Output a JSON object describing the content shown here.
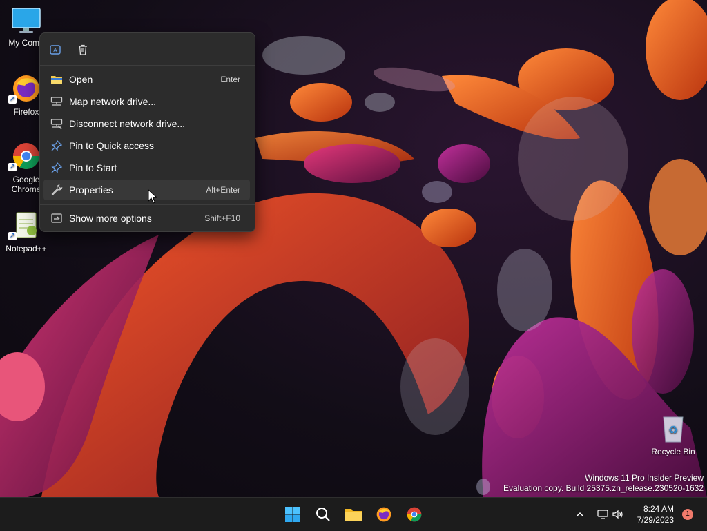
{
  "desktop": {
    "icons": [
      {
        "label": "My Comp"
      },
      {
        "label": "Firefox"
      },
      {
        "label": "Google Chrome"
      },
      {
        "label": "Notepad++"
      },
      {
        "label": "Recycle Bin"
      }
    ]
  },
  "context_menu": {
    "quick_actions": [
      {
        "icon": "rename-icon"
      },
      {
        "icon": "delete-icon"
      }
    ],
    "items": [
      {
        "label": "Open",
        "shortcut": "Enter",
        "icon": "folder-icon"
      },
      {
        "label": "Map network drive...",
        "shortcut": "",
        "icon": "network-drive-icon"
      },
      {
        "label": "Disconnect network drive...",
        "shortcut": "",
        "icon": "disconnect-drive-icon"
      },
      {
        "label": "Pin to Quick access",
        "shortcut": "",
        "icon": "pin-icon"
      },
      {
        "label": "Pin to Start",
        "shortcut": "",
        "icon": "pin-icon"
      },
      {
        "label": "Properties",
        "shortcut": "Alt+Enter",
        "icon": "wrench-icon"
      },
      {
        "label": "Show more options",
        "shortcut": "Shift+F10",
        "icon": "more-options-icon"
      }
    ],
    "hovered": "Properties"
  },
  "watermark": {
    "line1": "Windows 11 Pro Insider Preview",
    "line2": "Evaluation copy. Build 25375.zn_release.230520-1632"
  },
  "taskbar": {
    "apps": [
      {
        "name": "start-icon"
      },
      {
        "name": "search-icon"
      },
      {
        "name": "file-explorer-icon"
      },
      {
        "name": "firefox-icon"
      },
      {
        "name": "chrome-icon"
      }
    ],
    "tray": {
      "time": "8:24 AM",
      "date": "7/29/2023",
      "notification_count": "1"
    }
  },
  "colors": {
    "menu_bg": "#2c2c2c",
    "hover_bg": "#383838",
    "pin_blue": "#6aa0e8",
    "taskbar_bg": "#1c1c1c"
  }
}
